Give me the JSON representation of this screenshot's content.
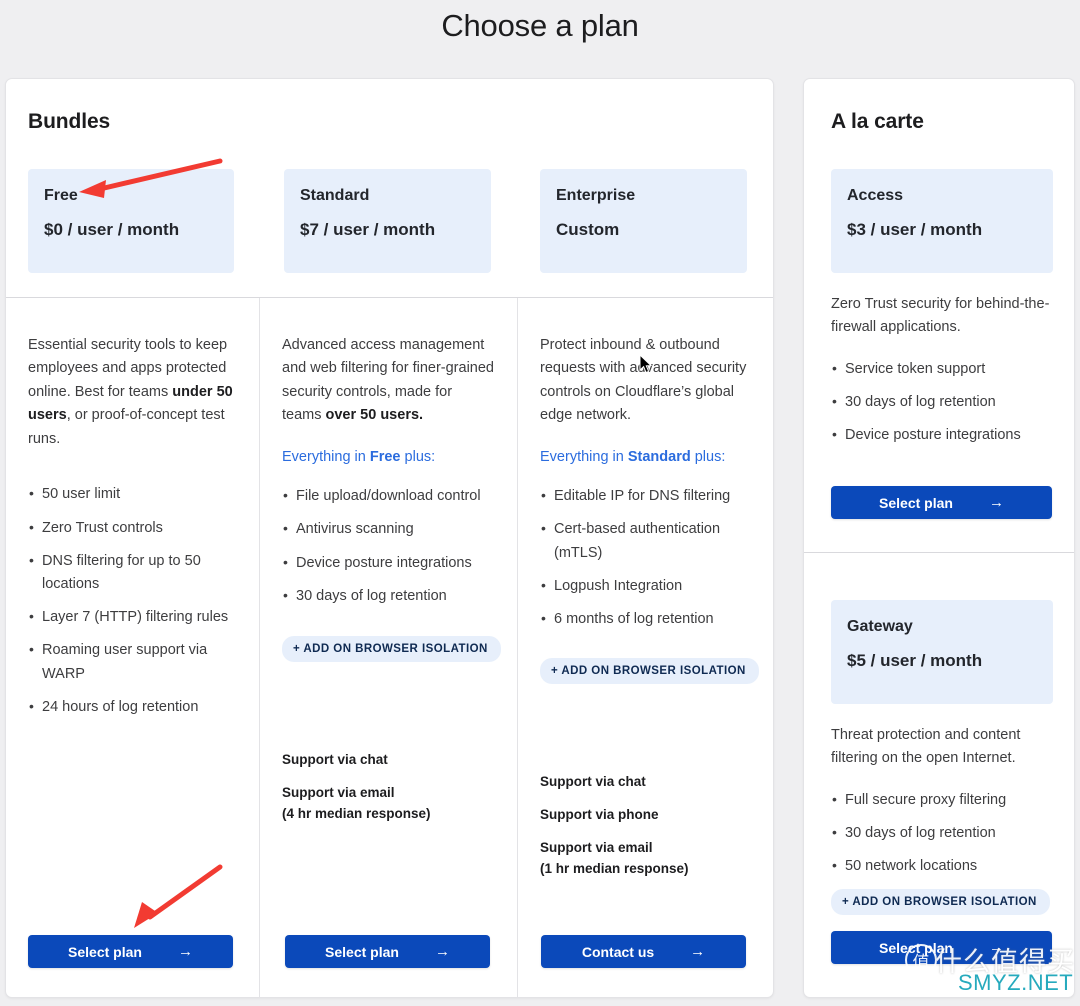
{
  "page": {
    "title": "Choose a plan",
    "accent_blue": "#2b6cde",
    "button_blue": "#0b49ba",
    "chip_bg": "#e7effb",
    "background": "#efeff1",
    "annotation_red": "#f23b32"
  },
  "bundles": {
    "heading": "Bundles",
    "plans": [
      {
        "name": "Free",
        "price": "$0 / user / month"
      },
      {
        "name": "Standard",
        "price": "$7 / user / month"
      },
      {
        "name": "Enterprise",
        "price": "Custom"
      }
    ],
    "columns": [
      {
        "blurb_parts": [
          {
            "text": "Essential security tools to keep employees and apps protected online. Best for teams ",
            "bold": false
          },
          {
            "text": "under 50 users",
            "bold": true
          },
          {
            "text": ", or proof-of-concept test runs.",
            "bold": false
          }
        ],
        "everything_in": null,
        "features": [
          "50 user limit",
          "Zero Trust controls",
          "DNS filtering for up to 50 locations",
          "Layer 7 (HTTP) filtering rules",
          "Roaming user support via WARP",
          "24 hours of log retention"
        ],
        "addon_badge": null,
        "support": [],
        "cta": {
          "label": "Select plan",
          "arrow": "→"
        }
      },
      {
        "blurb_parts": [
          {
            "text": "Advanced access management and web filtering for finer-grained security controls, made for teams ",
            "bold": false
          },
          {
            "text": "over 50 users.",
            "bold": true
          }
        ],
        "everything_in": {
          "prefix": "Everything in ",
          "plan": "Free",
          "suffix": " plus:"
        },
        "features": [
          "File upload/download control",
          "Antivirus scanning",
          "Device posture integrations",
          "30 days of log retention"
        ],
        "addon_badge": "+ ADD ON BROWSER ISOLATION",
        "support": [
          {
            "main": "Support via chat",
            "sub": null
          },
          {
            "main": "Support via email",
            "sub": "(4 hr median response)"
          }
        ],
        "cta": {
          "label": "Select plan",
          "arrow": "→"
        }
      },
      {
        "blurb_parts": [
          {
            "text": "Protect inbound & outbound requests with advanced security controls on Cloudflare’s global edge network.",
            "bold": false
          }
        ],
        "everything_in": {
          "prefix": "Everything in ",
          "plan": "Standard",
          "suffix": " plus:"
        },
        "features": [
          "Editable IP for DNS filtering",
          "Cert-based authentication (mTLS)",
          "Logpush Integration",
          "6 months of log retention"
        ],
        "addon_badge": "+ ADD ON BROWSER ISOLATION",
        "support": [
          {
            "main": "Support via chat",
            "sub": null
          },
          {
            "main": "Support via phone",
            "sub": null
          },
          {
            "main": "Support via email",
            "sub": "(1 hr median response)"
          }
        ],
        "cta": {
          "label": "Contact us",
          "arrow": "→"
        }
      }
    ]
  },
  "alacarte": {
    "heading": "A la carte",
    "products": [
      {
        "name": "Access",
        "price": "$3 / user / month",
        "description": "Zero Trust security for behind-the-firewall applications.",
        "features": [
          "Service token support",
          "30 days of log retention",
          "Device posture integrations"
        ],
        "addon_badge": null,
        "cta": {
          "label": "Select plan",
          "arrow": "→"
        }
      },
      {
        "name": "Gateway",
        "price": "$5 / user / month",
        "description": "Threat protection and content filtering on the open Internet.",
        "features": [
          "Full secure proxy filtering",
          "30 days of log retention",
          "50 network locations"
        ],
        "addon_badge": "+ ADD ON BROWSER ISOLATION",
        "cta": {
          "label": "Select plan",
          "arrow": "→"
        }
      }
    ]
  },
  "watermark": {
    "chinese": "什么值得买",
    "logo_glyph": "值",
    "site": "SMYZ.NET"
  }
}
